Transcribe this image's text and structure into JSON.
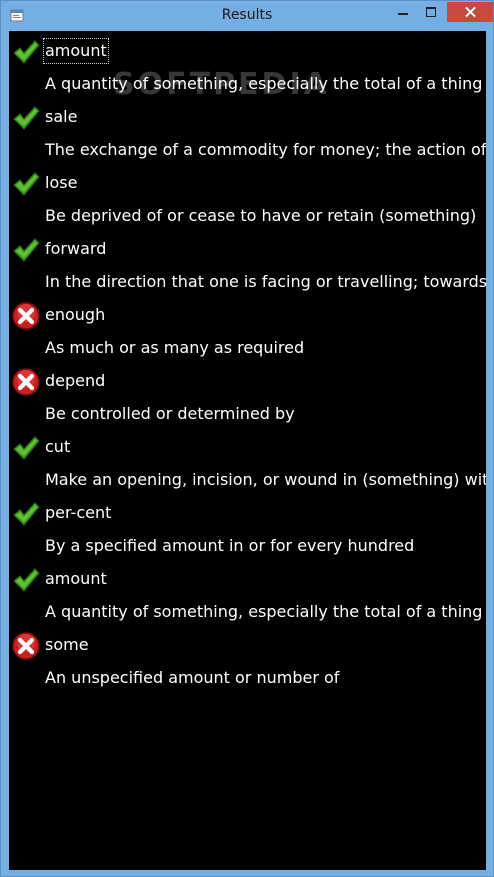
{
  "window": {
    "title": "Results"
  },
  "watermark": "SOFTPEDIA",
  "results": [
    {
      "word": "amount",
      "definition": "A quantity of something, especially the total of a thing or things in number, size, value, or extent",
      "status": "correct",
      "focused": true
    },
    {
      "word": "sale",
      "definition": "The exchange of a commodity for money; the action of selling something",
      "status": "correct"
    },
    {
      "word": "lose",
      "definition": "Be deprived of or cease to have or retain (something)",
      "status": "correct"
    },
    {
      "word": "forward",
      "definition": "In the direction that one is facing or travelling; towards the front",
      "status": "correct"
    },
    {
      "word": "enough",
      "definition": "As much or as many as required",
      "status": "wrong"
    },
    {
      "word": "depend",
      "definition": "Be controlled or determined by",
      "status": "wrong"
    },
    {
      "word": "cut",
      "definition": "Make an opening, incision, or wound in (something) with a sharp-edged tool",
      "status": "correct"
    },
    {
      "word": "per-cent",
      "definition": "By a specified amount in or for every hundred",
      "status": "correct"
    },
    {
      "word": "amount",
      "definition": "A quantity of something, especially the total of a thing or things in number, size, value, or extent",
      "status": "correct"
    },
    {
      "word": "some",
      "definition": "An unspecified amount or number of",
      "status": "wrong"
    }
  ],
  "colors": {
    "background": "#000000",
    "text": "#ffffff",
    "check": "#4caf2a",
    "cross": "#d32626",
    "titlebar": "#75aee4",
    "close": "#c74a3f"
  },
  "icons": {
    "correct": "check-icon",
    "wrong": "cross-icon"
  }
}
